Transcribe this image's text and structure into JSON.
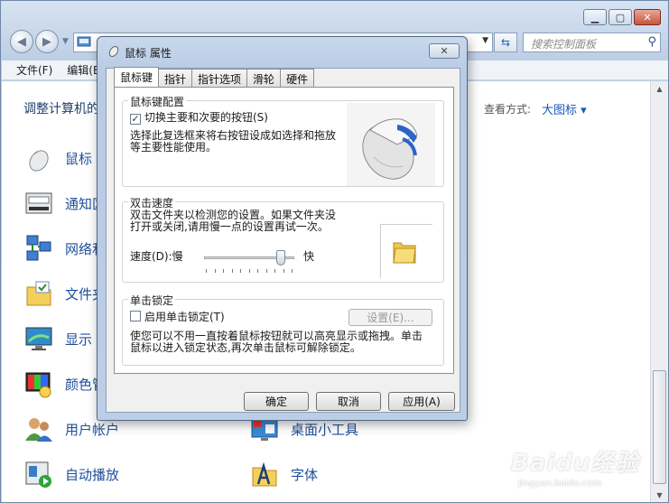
{
  "menubar": {
    "file": "文件(F)",
    "edit": "编辑(E)"
  },
  "search": {
    "placeholder": "搜索控制面板"
  },
  "content": {
    "title": "调整计算机的设置",
    "view_label": "查看方式:",
    "view_value": "大图标 ▾",
    "left_items": [
      "鼠标",
      "通知区域图标",
      "网络和共享中心",
      "文件夹选项",
      "显示",
      "颜色管理",
      "用户帐户",
      "自动播放"
    ],
    "right_items": [
      "桌面小工具",
      "字体"
    ]
  },
  "dialog": {
    "title": "鼠标 属性",
    "close": "✕",
    "tabs": [
      "鼠标键",
      "指针",
      "指针选项",
      "滑轮",
      "硬件"
    ],
    "button_config": {
      "title": "鼠标键配置",
      "switch_label": "切换主要和次要的按钮(S)",
      "switch_checked": "✓",
      "description_line1": "选择此复选框来将右按钮设成如选择和拖放",
      "description_line2": "等主要性能使用。"
    },
    "double_click": {
      "title": "双击速度",
      "description_line1": "双击文件夹以检测您的设置。如果文件夹没",
      "description_line2": "打开或关闭,请用慢一点的设置再试一次。",
      "speed_label": "速度(D):慢",
      "fast_label": "快",
      "speed_value": 0.85
    },
    "click_lock": {
      "title": "单击锁定",
      "enable_label": "启用单击锁定(T)",
      "settings_label": "设置(E)...",
      "description_line1": "使您可以不用一直按着鼠标按钮就可以高亮显示或拖拽。单击",
      "description_line2": "鼠标以进入锁定状态,再次单击鼠标可解除锁定。"
    },
    "buttons": {
      "ok": "确定",
      "cancel": "取消",
      "apply": "应用(A)"
    }
  },
  "watermark": {
    "text": "Baidu经验",
    "sub": "jingyan.baidu.com"
  }
}
